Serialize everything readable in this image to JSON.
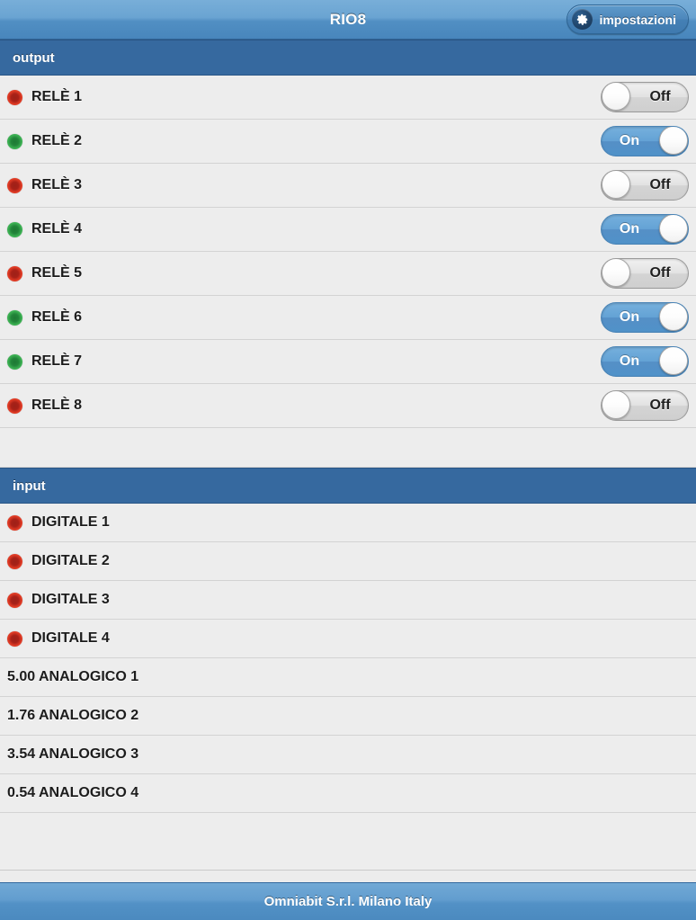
{
  "titlebar": {
    "title": "RIO8",
    "settings_button_label": "impostazioni",
    "gear_icon": "gear-icon"
  },
  "output_section": {
    "header_label": "output",
    "rows": [
      {
        "led": "red",
        "label": "RELÈ 1",
        "toggle_label": "Off",
        "toggle_state": "off"
      },
      {
        "led": "green",
        "label": "RELÈ 2",
        "toggle_label": "On",
        "toggle_state": "on"
      },
      {
        "led": "red",
        "label": "RELÈ 3",
        "toggle_label": "Off",
        "toggle_state": "off"
      },
      {
        "led": "green",
        "label": "RELÈ 4",
        "toggle_label": "On",
        "toggle_state": "on"
      },
      {
        "led": "red",
        "label": "RELÈ 5",
        "toggle_label": "Off",
        "toggle_state": "off"
      },
      {
        "led": "green",
        "label": "RELÈ 6",
        "toggle_label": "On",
        "toggle_state": "on"
      },
      {
        "led": "green",
        "label": "RELÈ 7",
        "toggle_label": "On",
        "toggle_state": "on"
      },
      {
        "led": "red",
        "label": "RELÈ 8",
        "toggle_label": "Off",
        "toggle_state": "off"
      }
    ]
  },
  "input_section": {
    "header_label": "input",
    "digital_rows": [
      {
        "led": "red",
        "label": "DIGITALE 1"
      },
      {
        "led": "red",
        "label": "DIGITALE 2"
      },
      {
        "led": "red",
        "label": "DIGITALE 3"
      },
      {
        "led": "red",
        "label": "DIGITALE 4"
      }
    ],
    "analog_rows": [
      {
        "label": "5.00 ANALOGICO 1"
      },
      {
        "label": "1.76 ANALOGICO 2"
      },
      {
        "label": "3.54 ANALOGICO 3"
      },
      {
        "label": "0.54 ANALOGICO 4"
      }
    ]
  },
  "footer": {
    "text": "Omniabit S.r.l. Milano Italy"
  },
  "colors": {
    "titlebar_blue_top": "#78aed8",
    "titlebar_blue_bottom": "#4886bc",
    "section_header_blue": "#36699f",
    "row_background": "#ededed",
    "led_red": "#e03b25",
    "led_green": "#3bb052",
    "toggle_on_blue": "#63a2d5",
    "toggle_off_gray": "#e2e2e2",
    "footer_blue": "#5291c6"
  }
}
